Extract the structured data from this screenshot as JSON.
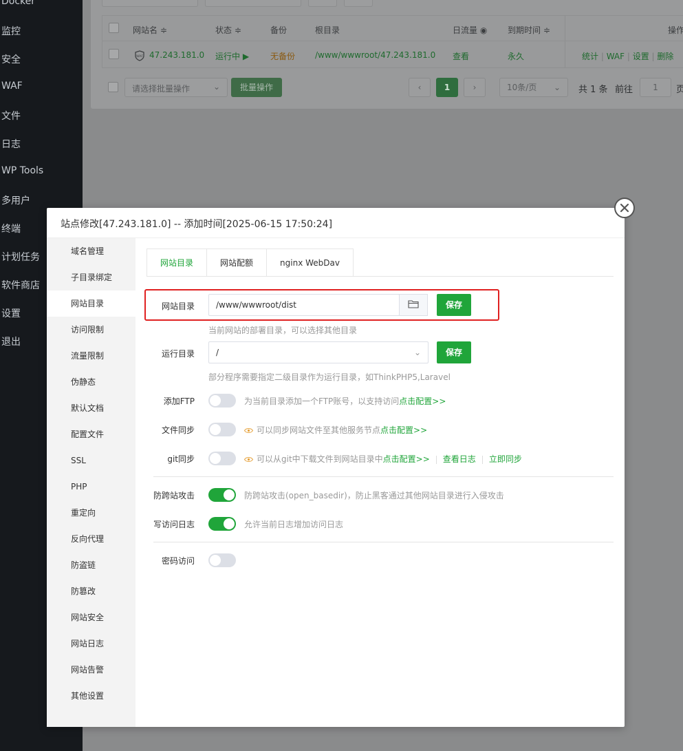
{
  "nav": {
    "items": [
      "Docker",
      "监控",
      "安全",
      "WAF",
      "文件",
      "日志",
      "WP Tools",
      "多用户",
      "终端",
      "计划任务",
      "软件商店",
      "设置",
      "退出"
    ]
  },
  "site_table": {
    "headers": {
      "name": "网站名 ≑",
      "status": "状态 ≑",
      "backup": "备份",
      "root": "根目录",
      "traffic": "日流量",
      "expire": "到期时间 ≑",
      "ops": "操作"
    },
    "row": {
      "name": "47.243.181.0",
      "status": "运行中 ▶",
      "backup": "无备份",
      "root": "/www/wwwroot/47.243.181.0",
      "traffic": "查看",
      "expire": "永久",
      "ops": [
        "统计",
        "WAF",
        "设置",
        "删除"
      ]
    },
    "bulk_placeholder": "请选择批量操作",
    "bulk_button": "批量操作",
    "pagination": {
      "prev": "‹",
      "current_page": "1",
      "next": "›",
      "per_page": "10条/页",
      "total": "共 1 条",
      "goto_label": "前往",
      "goto_value": "1",
      "page_suffix": "页"
    }
  },
  "modal": {
    "title": "站点修改[47.243.181.0] -- 添加时间[2025-06-15 17:50:24]",
    "sidebar": [
      "域名管理",
      "子目录绑定",
      "网站目录",
      "访问限制",
      "流量限制",
      "伪静态",
      "默认文档",
      "配置文件",
      "SSL",
      "PHP",
      "重定向",
      "反向代理",
      "防盗链",
      "防篡改",
      "网站安全",
      "网站日志",
      "网站告警",
      "其他设置"
    ],
    "active_sidebar": "网站目录",
    "tabs": [
      "网站目录",
      "网站配额",
      "nginx WebDav"
    ],
    "active_tab": "网站目录",
    "site_dir": {
      "label": "网站目录",
      "value": "/www/wwwroot/dist",
      "save": "保存",
      "hint": "当前网站的部署目录，可以选择其他目录"
    },
    "run_dir": {
      "label": "运行目录",
      "value": "/",
      "save": "保存",
      "hint": "部分程序需要指定二级目录作为运行目录，如ThinkPHP5,Laravel"
    },
    "ftp": {
      "label": "添加FTP",
      "enabled": false,
      "hint": "为当前目录添加一个FTP账号，以支持访问",
      "link": "点击配置>>"
    },
    "file_sync": {
      "label": "文件同步",
      "enabled": false,
      "hint": "可以同步网站文件至其他服务节点",
      "link": "点击配置>>"
    },
    "git_sync": {
      "label": "git同步",
      "enabled": false,
      "hint": "可以从git中下载文件到网站目录中",
      "link": "点击配置>>",
      "view_log": "查看日志",
      "sync_now": "立即同步"
    },
    "anti_cross": {
      "label": "防跨站攻击",
      "enabled": true,
      "hint": "防跨站攻击(open_basedir)，防止黑客通过其他网站目录进行入侵攻击"
    },
    "access_log": {
      "label": "写访问日志",
      "enabled": true,
      "hint": "允许当前日志增加访问日志"
    },
    "password": {
      "label": "密码访问",
      "enabled": false
    }
  },
  "colors": {
    "accent": "#20a53a",
    "highlight": "#e02020"
  }
}
